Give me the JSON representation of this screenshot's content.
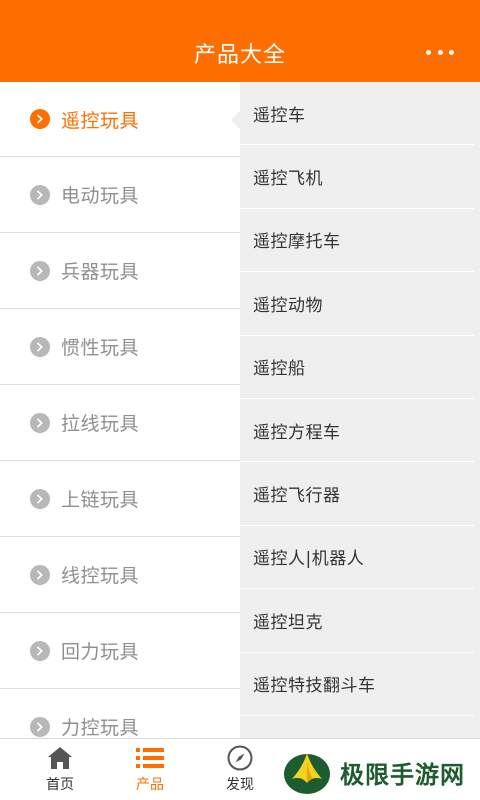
{
  "header": {
    "title": "产品大全",
    "more_icon": "more-dots-icon"
  },
  "categories": [
    {
      "label": "遥控玩具",
      "active": true
    },
    {
      "label": "电动玩具",
      "active": false
    },
    {
      "label": "兵器玩具",
      "active": false
    },
    {
      "label": "惯性玩具",
      "active": false
    },
    {
      "label": "拉线玩具",
      "active": false
    },
    {
      "label": "上链玩具",
      "active": false
    },
    {
      "label": "线控玩具",
      "active": false
    },
    {
      "label": "回力玩具",
      "active": false
    },
    {
      "label": "力控玩具",
      "active": false
    }
  ],
  "subcategories": [
    "遥控车",
    "遥控飞机",
    "遥控摩托车",
    "遥控动物",
    "遥控船",
    "遥控方程车",
    "遥控飞行器",
    "遥控人|机器人",
    "遥控坦克",
    "遥控特技翻斗车"
  ],
  "tabbar": {
    "tabs": [
      {
        "label": "首页",
        "icon": "home-icon",
        "active": false
      },
      {
        "label": "产品",
        "icon": "list-icon",
        "active": true
      },
      {
        "label": "发现",
        "icon": "compass-icon",
        "active": false
      }
    ]
  },
  "watermark": {
    "text": "极限手游网"
  },
  "colors": {
    "accent": "#ff6e00",
    "inactive": "#8f8f8f",
    "panel": "#efefef"
  }
}
